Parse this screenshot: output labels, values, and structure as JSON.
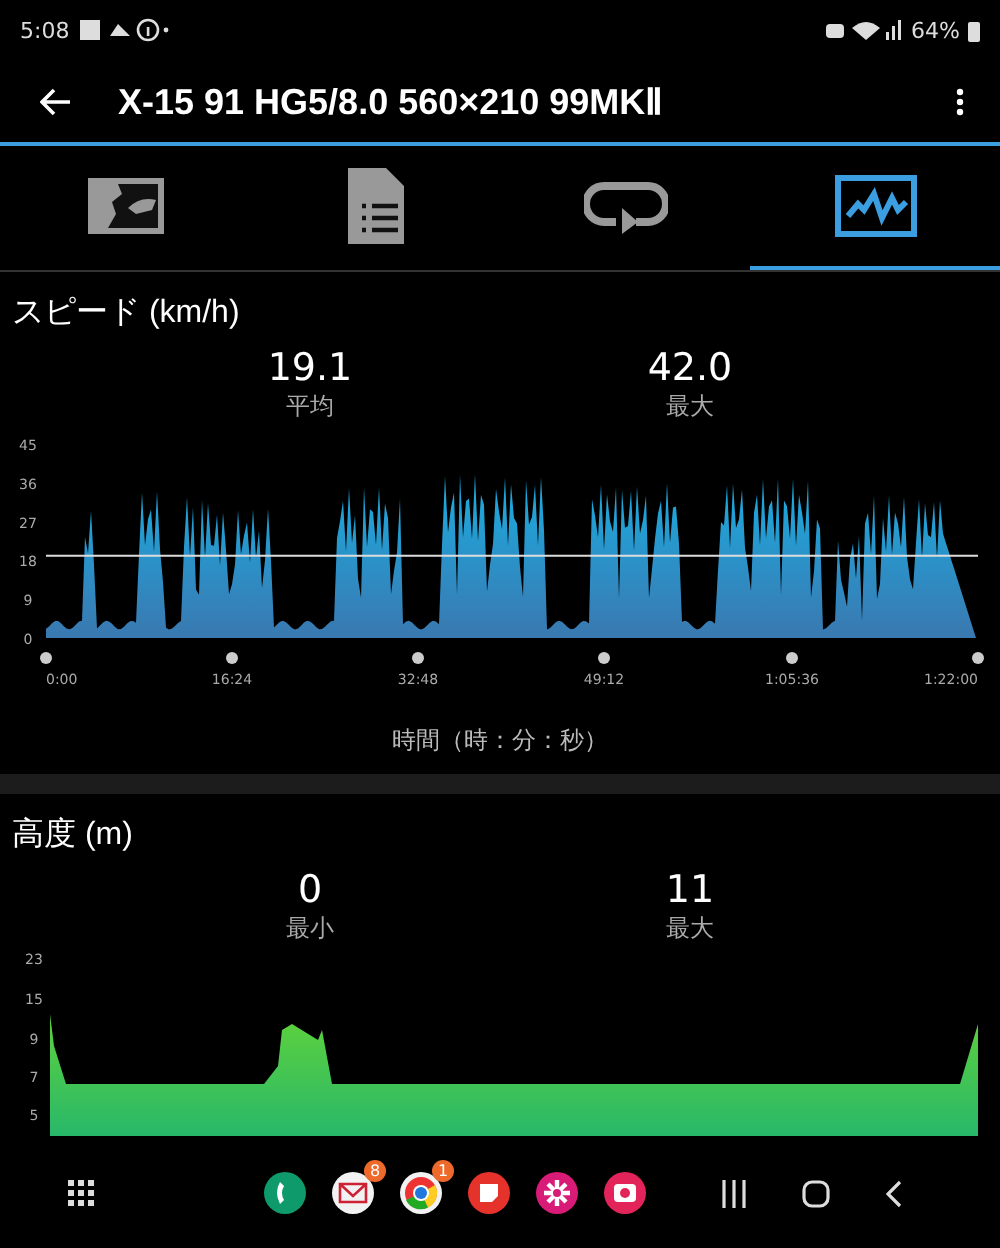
{
  "status_bar": {
    "time": "5:08",
    "battery": "64%"
  },
  "toolbar": {
    "title": "X-15 91 HG5/8.0 560×210 99MKⅡ"
  },
  "tabs": [
    {
      "kind": "map",
      "selected": false
    },
    {
      "kind": "document",
      "selected": false
    },
    {
      "kind": "loop",
      "selected": false
    },
    {
      "kind": "graph",
      "selected": true
    }
  ],
  "speed": {
    "title": "スピード (km/h)",
    "stats": [
      {
        "value": "19.1",
        "label": "平均"
      },
      {
        "value": "42.0",
        "label": "最大"
      }
    ],
    "yticks": [
      "45",
      "36",
      "27",
      "18",
      "9",
      "0"
    ],
    "xticks": [
      "0:00",
      "16:24",
      "32:48",
      "49:12",
      "1:05:36",
      "1:22:00"
    ],
    "axis_title": "時間（時：分：秒）"
  },
  "altitude": {
    "title": "高度 (m)",
    "stats": [
      {
        "value": "0",
        "label": "最小"
      },
      {
        "value": "11",
        "label": "最大"
      }
    ],
    "yticks": [
      "23",
      "15",
      "9",
      "7",
      "5"
    ]
  },
  "dock": {
    "apps": [
      {
        "kind": "phone"
      },
      {
        "kind": "mail",
        "badge": "8"
      },
      {
        "kind": "browser",
        "badge": "1"
      },
      {
        "kind": "notes"
      },
      {
        "kind": "flower"
      },
      {
        "kind": "camera"
      }
    ]
  }
}
